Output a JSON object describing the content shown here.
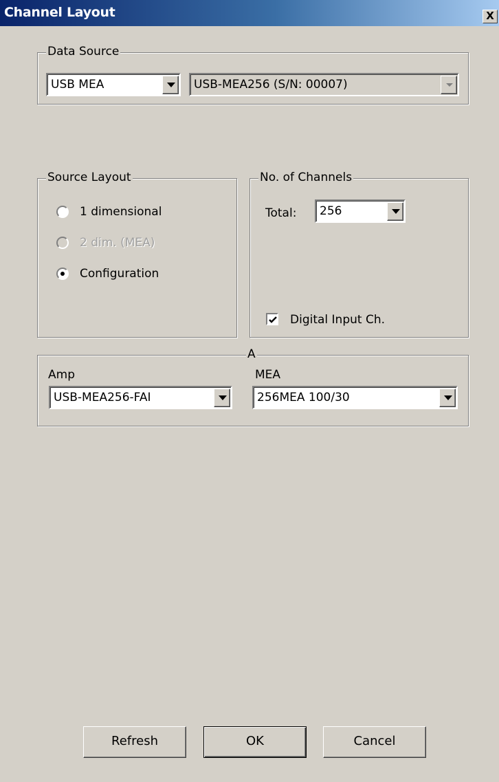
{
  "window": {
    "title": "Channel Layout",
    "close_glyph": "X"
  },
  "data_source": {
    "legend": "Data Source",
    "source_type": "USB MEA",
    "device": "USB-MEA256 (S/N: 00007)"
  },
  "source_layout": {
    "legend": "Source Layout",
    "options": [
      {
        "label": "1 dimensional",
        "selected": false,
        "enabled": true
      },
      {
        "label": "2 dim. (MEA)",
        "selected": false,
        "enabled": false
      },
      {
        "label": "Configuration",
        "selected": true,
        "enabled": true
      }
    ]
  },
  "channels": {
    "legend": "No. of Channels",
    "total_label": "Total:",
    "total_value": "256",
    "digital_input_label": "Digital Input Ch.",
    "digital_input_checked": true
  },
  "config_group": {
    "legend": "A",
    "amp_label": "Amp",
    "amp_value": "USB-MEA256-FAI",
    "mea_label": "MEA",
    "mea_value": "256MEA 100/30"
  },
  "buttons": {
    "refresh": "Refresh",
    "ok": "OK",
    "cancel": "Cancel"
  },
  "icons": {
    "dropdown": "chevron-down-icon",
    "close": "close-icon",
    "check": "checkmark-icon"
  }
}
